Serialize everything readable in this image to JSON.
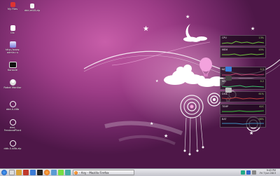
{
  "desktop_icons": [
    {
      "name": "recycle-bin-icon",
      "label": "My Files"
    },
    {
      "name": "file-archive-icon",
      "label": "ddd-ef48.zip"
    },
    {
      "name": "file-icon",
      "label": "Gfc"
    },
    {
      "name": "internet-shortcut-icon",
      "label": "http://www.\nadmin.ru"
    },
    {
      "name": "terminal-icon",
      "label": "Konsole"
    },
    {
      "name": "user-icon",
      "label": "Robot Monitor"
    },
    {
      "name": "circle-folder-icon",
      "label": "ddd-0-48b"
    },
    {
      "name": "circle-folder-icon",
      "label": "ddd-\nFendandPlant"
    },
    {
      "name": "circle-folder-icon",
      "label": "ddb-0-48b.zip"
    }
  ],
  "widgets": [
    {
      "label": "CPU",
      "value": "13%",
      "color": "#6fbf3f"
    },
    {
      "label": "MEM",
      "value": "45%",
      "color": "#6fbf3f"
    },
    {
      "label": "NET",
      "value": "0.5",
      "color": "#bf3f6f"
    },
    {
      "label": "NET",
      "value": "0.2",
      "color": "#3fbf6f"
    },
    {
      "label": "DISK",
      "value": "61%",
      "color": "#bf3f3f"
    },
    {
      "label": "TEMP",
      "value": "42C",
      "color": "#3fbf3f"
    },
    {
      "label": "BAT",
      "value": "98%",
      "color": "#3f8fbf"
    }
  ],
  "taskbar": {
    "start_label": "Start",
    "task_title": "- Any - Mozilla Firefox",
    "clock_time": "9:43 PM",
    "clock_date": "Fri 7 Jun 2013"
  },
  "colors": {
    "wallpaper_main": "#9c3c86",
    "wallpaper_dark": "#4e1748",
    "accent_pink": "#f07fc8"
  }
}
